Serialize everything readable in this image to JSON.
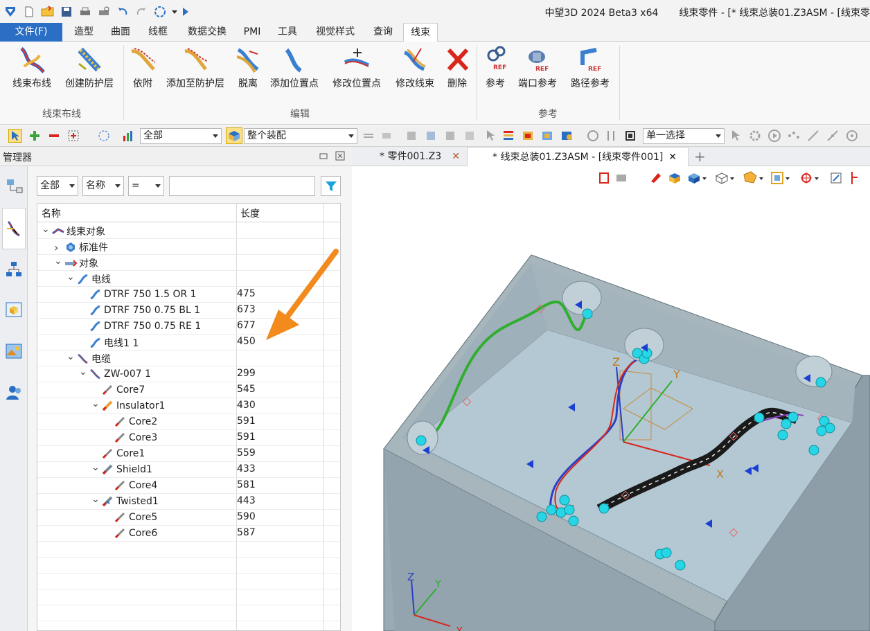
{
  "title_bar": {
    "app": "中望3D 2024 Beta3 x64",
    "doc_title": "线束零件 - [* 线束总装01.Z3ASM - [线束零"
  },
  "menu": {
    "file": "文件(F)",
    "tabs": [
      "造型",
      "曲面",
      "线框",
      "数据交换",
      "PMI",
      "工具",
      "视觉样式",
      "查询",
      "线束"
    ],
    "active": "线束"
  },
  "ribbon": {
    "groups": [
      {
        "name": "线束布线",
        "buttons": [
          "线束布线",
          "创建防护层"
        ]
      },
      {
        "name": "编辑",
        "buttons": [
          "依附",
          "添加至防护层",
          "脱离",
          "添加位置点",
          "修改位置点",
          "修改线束",
          "删除"
        ]
      },
      {
        "name": "参考",
        "buttons": [
          "参考",
          "端口参考",
          "路径参考"
        ]
      }
    ]
  },
  "toolbar": {
    "filter_select": "全部",
    "assembly_select": "整个装配",
    "selection_mode": "单一选择"
  },
  "manager": {
    "title": "管理器",
    "filter": {
      "scope": "全部",
      "field": "名称",
      "op": "=",
      "value": ""
    },
    "columns": [
      "名称",
      "长度"
    ],
    "rows": [
      {
        "label": "线束对象",
        "len": "",
        "level": 0,
        "toggle": "open",
        "icon": "harness-icon"
      },
      {
        "label": "标准件",
        "len": "",
        "level": 1,
        "toggle": "closed",
        "icon": "standard-part-icon"
      },
      {
        "label": "对象",
        "len": "",
        "level": 1,
        "toggle": "open",
        "icon": "object-icon"
      },
      {
        "label": "电线",
        "len": "",
        "level": 2,
        "toggle": "open",
        "icon": "wire-icon"
      },
      {
        "label": "DTRF 750 1.5 OR 1",
        "len": "475",
        "level": 3,
        "toggle": "",
        "icon": "wire-icon"
      },
      {
        "label": "DTRF 750 0.75 BL 1",
        "len": "673",
        "level": 3,
        "toggle": "",
        "icon": "wire-icon"
      },
      {
        "label": "DTRF 750 0.75 RE 1",
        "len": "677",
        "level": 3,
        "toggle": "",
        "icon": "wire-icon"
      },
      {
        "label": "电线1 1",
        "len": "450",
        "level": 3,
        "toggle": "",
        "icon": "wire-icon"
      },
      {
        "label": "电缆",
        "len": "",
        "level": 2,
        "toggle": "open",
        "icon": "cable-icon"
      },
      {
        "label": "ZW-007 1",
        "len": "299",
        "level": 3,
        "toggle": "open",
        "icon": "cable-icon"
      },
      {
        "label": "Core7",
        "len": "545",
        "level": 4,
        "toggle": "",
        "icon": "core-icon"
      },
      {
        "label": "Insulator1",
        "len": "430",
        "level": 4,
        "toggle": "open",
        "icon": "insulator-icon"
      },
      {
        "label": "Core2",
        "len": "591",
        "level": 5,
        "toggle": "",
        "icon": "core-icon"
      },
      {
        "label": "Core3",
        "len": "591",
        "level": 5,
        "toggle": "",
        "icon": "core-icon"
      },
      {
        "label": "Core1",
        "len": "559",
        "level": 4,
        "toggle": "",
        "icon": "core-icon"
      },
      {
        "label": "Shield1",
        "len": "433",
        "level": 4,
        "toggle": "open",
        "icon": "shield-icon"
      },
      {
        "label": "Core4",
        "len": "581",
        "level": 5,
        "toggle": "",
        "icon": "core-icon"
      },
      {
        "label": "Twisted1",
        "len": "443",
        "level": 4,
        "toggle": "open",
        "icon": "twisted-icon"
      },
      {
        "label": "Core5",
        "len": "590",
        "level": 5,
        "toggle": "",
        "icon": "core-icon"
      },
      {
        "label": "Core6",
        "len": "587",
        "level": 5,
        "toggle": "",
        "icon": "core-icon"
      }
    ]
  },
  "doc_tabs": [
    {
      "label": "* 零件001.Z3",
      "active": false
    },
    {
      "label": "* 线束总装01.Z3ASM - [线束零件001]",
      "active": true
    }
  ],
  "viewport": {
    "axis_labels": {
      "z": "Z",
      "y": "Y",
      "x": "X"
    },
    "triad_labels": {
      "z": "Z",
      "y": "Y",
      "x": "X"
    }
  },
  "colors": {
    "accent": "#2a6fc4",
    "arrow": "#f28a1e",
    "box": "#9aaab4",
    "wire_green": "#2fae2f",
    "cable_black": "#1a1a1a",
    "connector_cyan": "#27d6e6"
  }
}
